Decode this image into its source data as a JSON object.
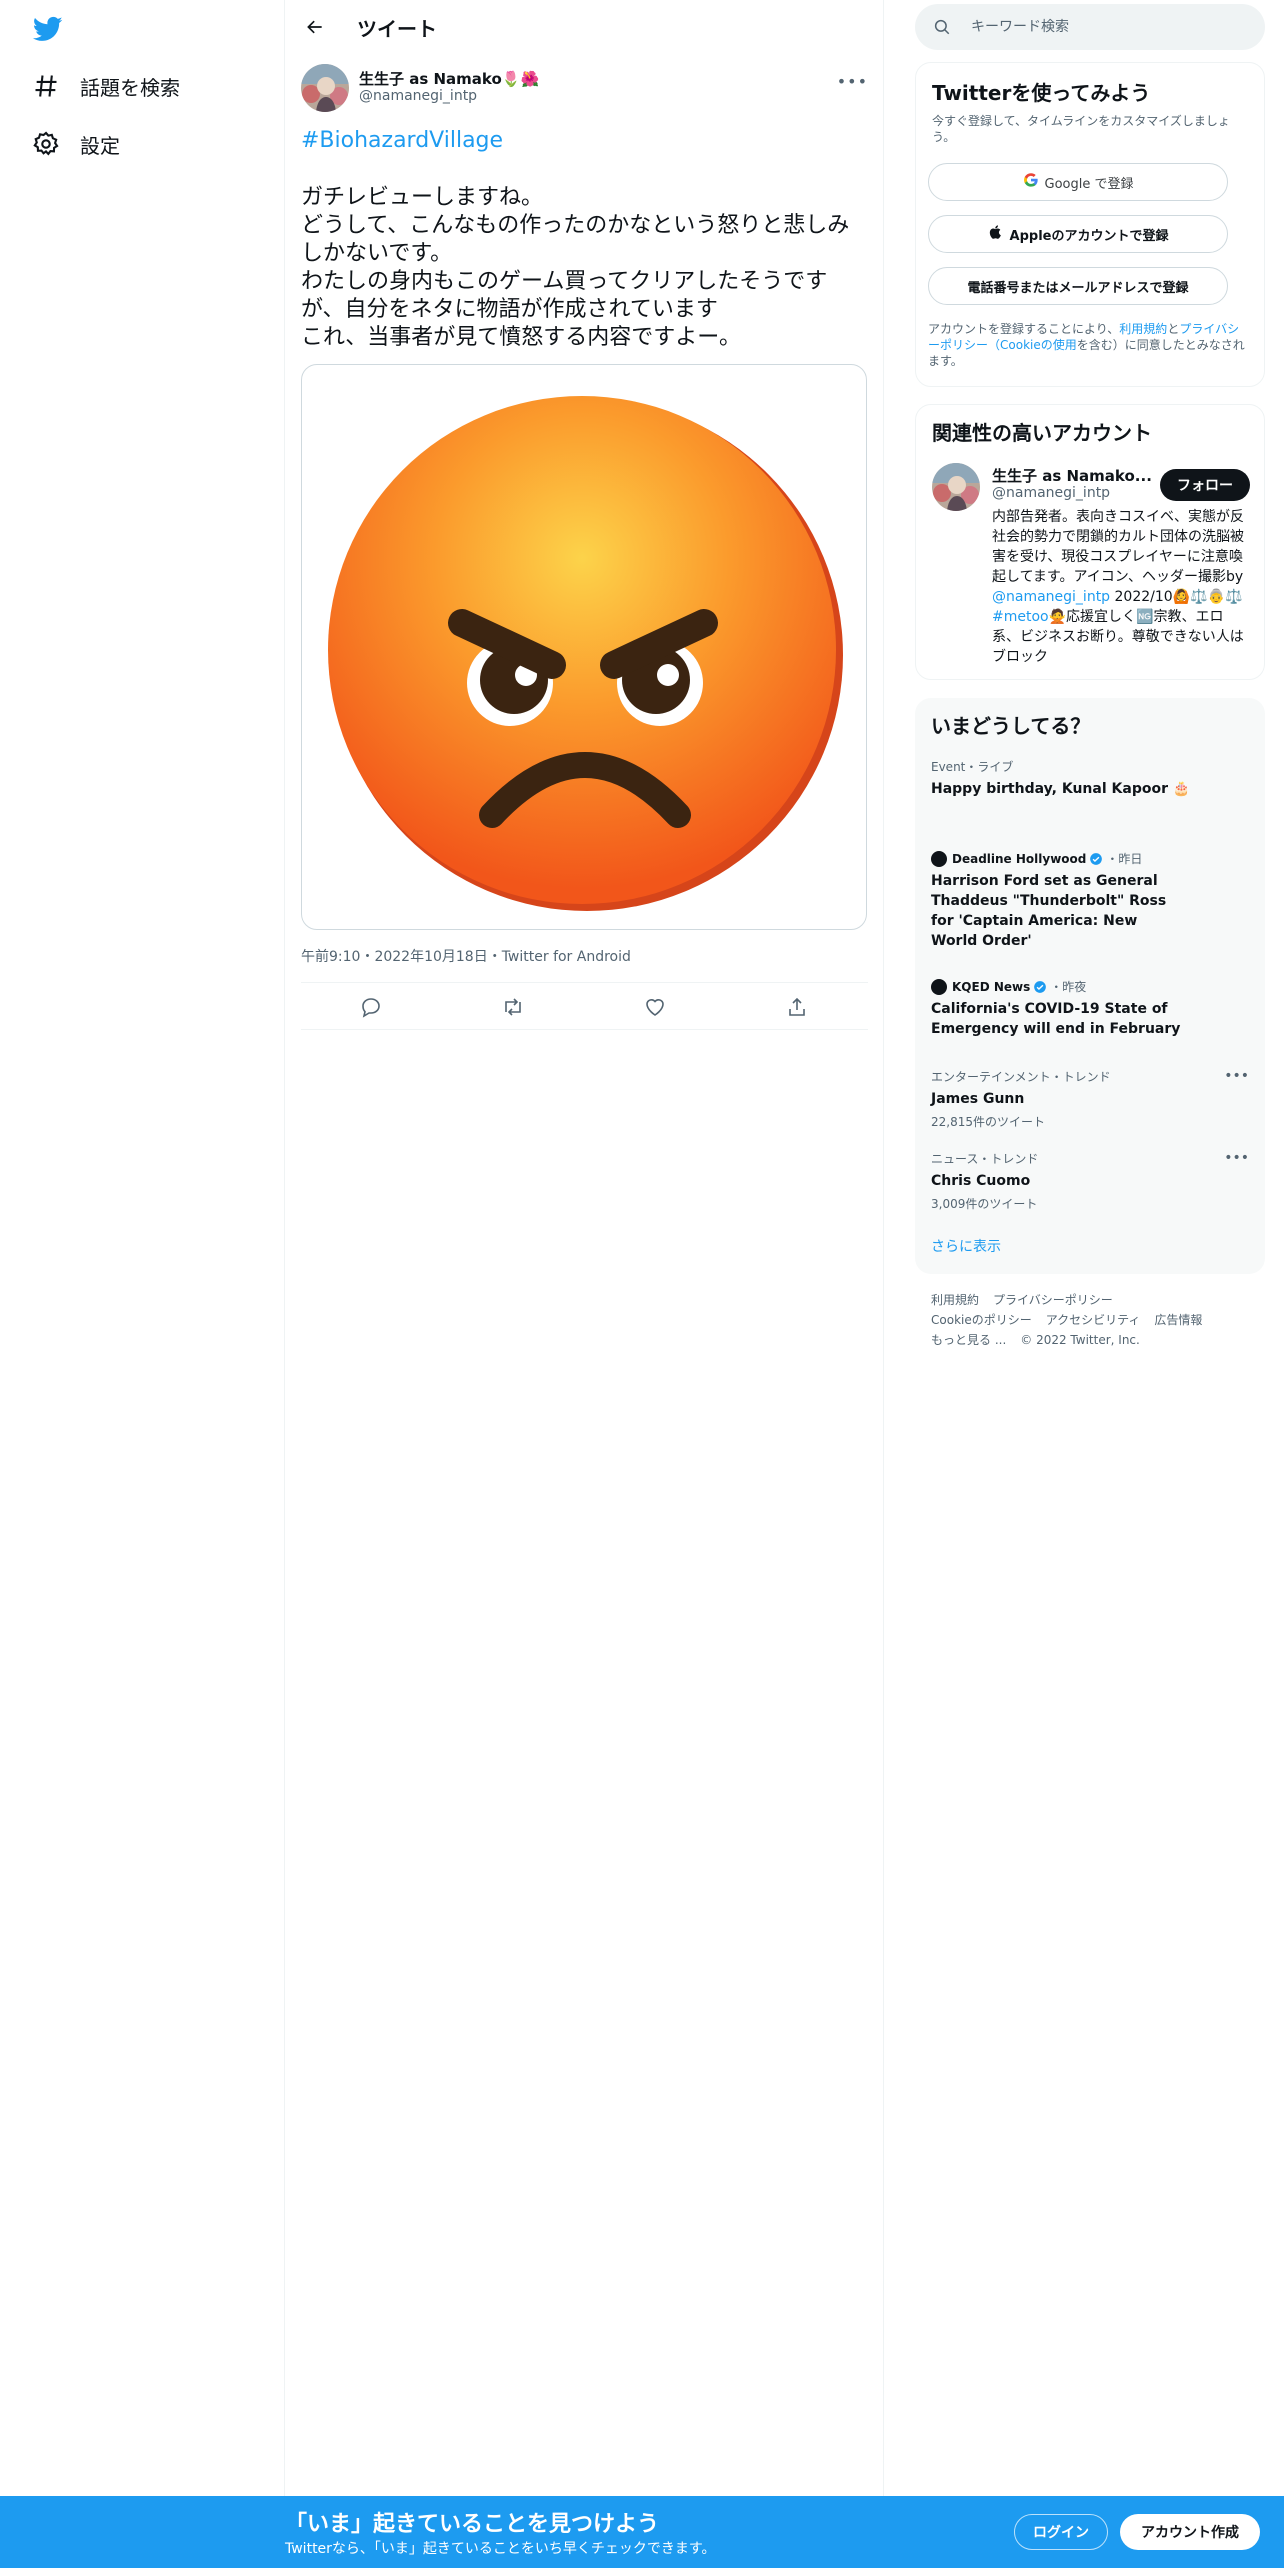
{
  "colors": {
    "accent": "#1d9bf0",
    "text": "#0f1419",
    "secondary": "#536471",
    "border": "#eff3f4"
  },
  "sidebar": {
    "logo_icon": "twitter-bird-icon",
    "items": [
      {
        "icon": "hashtag-icon",
        "label": "話題を検索"
      },
      {
        "icon": "gear-icon",
        "label": "設定"
      }
    ]
  },
  "header": {
    "title": "ツイート"
  },
  "tweet": {
    "author_name": "生生子 as Namako🌷🌺",
    "author_handle": "@namanegi_intp",
    "hashtag": "#BiohazardVillage",
    "text": "ガチレビューしますね。\nどうして、こんなもの作ったのかなという怒りと悲しみしかないです。\nわたしの身内もこのゲーム買ってクリアしたそうですが、自分をネタに物語が作成されています\nこれ、当事者が見て憤怒する内容ですよー。",
    "media_icon": "angry-face-emoji",
    "meta": "午前9:10・2022年10月18日・Twitter for Android"
  },
  "search": {
    "placeholder": "キーワード検索"
  },
  "signup_card": {
    "title": "Twitterを使ってみよう",
    "subtitle": "今すぐ登録して、タイムラインをカスタマイズしましょう。",
    "google": "Google で登録",
    "apple": "Appleのアカウントで登録",
    "phone": "電話番号またはメールアドレスで登録",
    "legal_1": "アカウントを登録することにより、",
    "legal_terms": "利用規約",
    "legal_2": "と",
    "legal_privacy": "プライバシーポリシー（Cookieの使用",
    "legal_3": "を含む）に同意したとみなされます。"
  },
  "related_card": {
    "title": "関連性の高いアカウント",
    "name": "生生子 as Namako...",
    "handle": "@namanegi_intp",
    "follow": "フォロー",
    "bio_1": "内部告発者。表向きコスイベ、実態が反社会的勢力で閉鎖的カルト団体の洗脳被害を受け、現役コスプレイヤーに注意喚起してます。アイコン、ヘッダー撮影by ",
    "bio_link": "@namanegi_intp",
    "bio_2": " 2022/10🙆⚖️👵⚖️ ",
    "bio_tag": "#metoo",
    "bio_3": "🙅応援宜しく🆖宗教、エロ系、ビジネスお断り。尊敬できない人はブロック"
  },
  "trends_card": {
    "title": "いまどうしてる？",
    "items": [
      {
        "category": "Event・ライブ",
        "title": "Happy birthday, Kunal Kapoor 🎂"
      },
      {
        "source": "Deadline Hollywood",
        "time": "・昨日",
        "title": "Harrison Ford set as General Thaddeus \"Thunderbolt\" Ross for 'Captain America: New World Order'"
      },
      {
        "source": "KQED News",
        "time": "・昨夜",
        "title": "California's COVID-19 State of Emergency will end in February"
      },
      {
        "category": "エンターテインメント・トレンド",
        "title": "James Gunn",
        "count": "22,815件のツイート"
      },
      {
        "category": "ニュース・トレンド",
        "title": "Chris Cuomo",
        "count": "3,009件のツイート"
      }
    ],
    "show_more": "さらに表示"
  },
  "footer": {
    "links": [
      "利用規約",
      "プライバシーポリシー",
      "Cookieのポリシー",
      "アクセシビリティ",
      "広告情報",
      "もっと見る ..."
    ],
    "copyright": "© 2022 Twitter, Inc."
  },
  "bottom_bar": {
    "title": "「いま」起きていることを見つけよう",
    "subtitle": "Twitterなら、「いま」起きていることをいち早くチェックできます。",
    "login": "ログイン",
    "signup": "アカウント作成"
  }
}
